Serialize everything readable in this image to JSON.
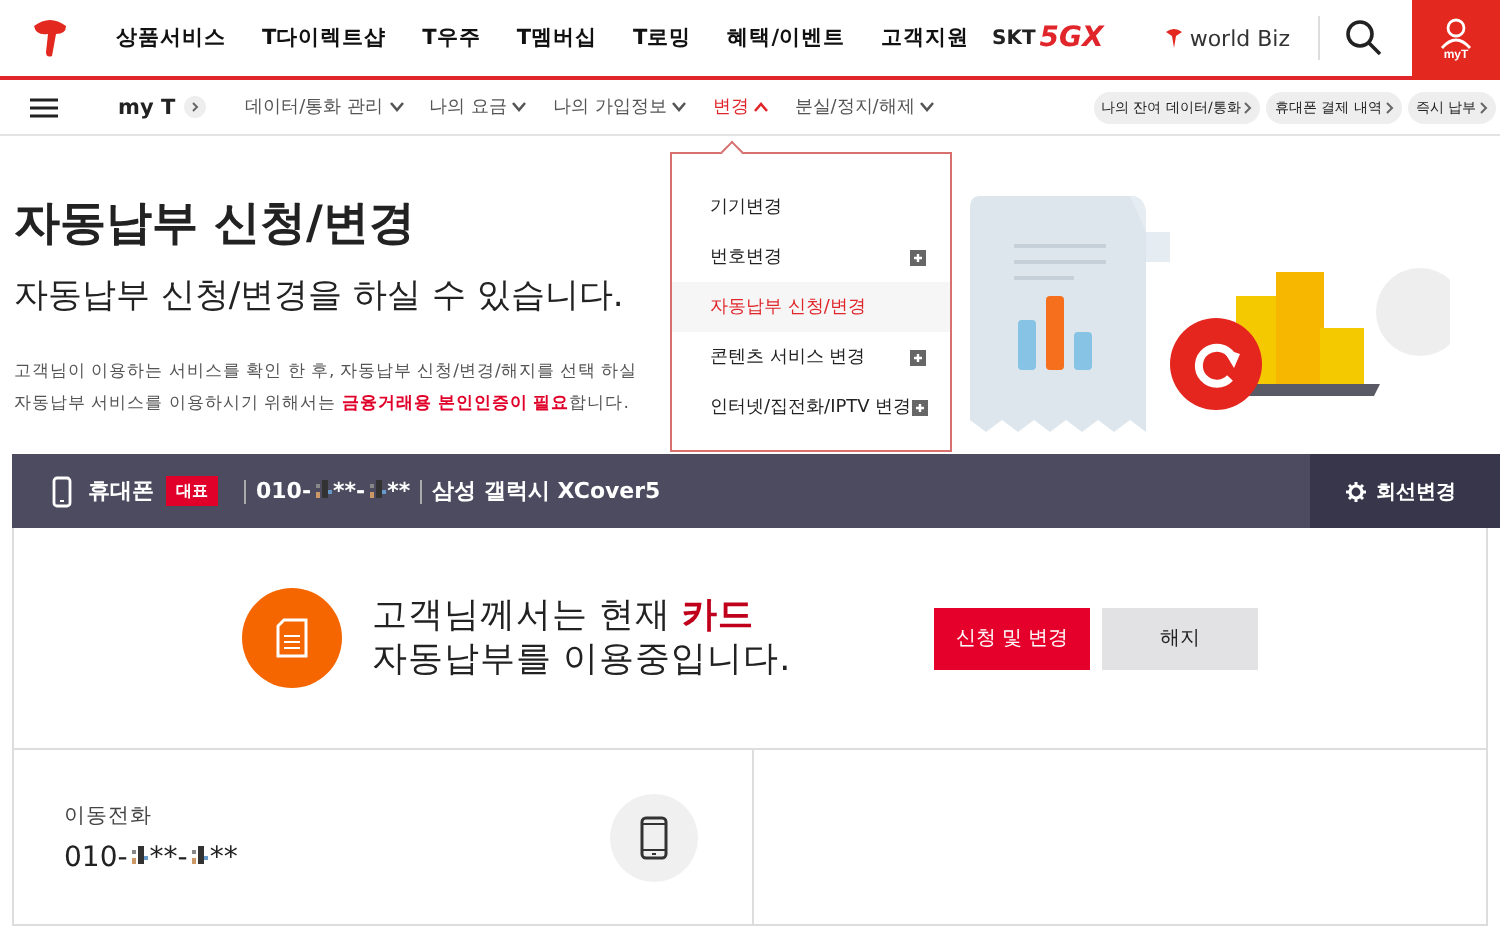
{
  "header": {
    "menu": [
      "상품서비스",
      "T다이렉트샵",
      "T우주",
      "T멤버십",
      "T로밍",
      "혜택/이벤트",
      "고객지원"
    ],
    "brand": "SKT",
    "brand_mark": "5GX",
    "partner": "world Biz",
    "account_label": "myT"
  },
  "nav": {
    "home": "my T",
    "items": [
      {
        "label": "데이터/통화 관리",
        "selected": false,
        "expanded": false
      },
      {
        "label": "나의 요금",
        "selected": false,
        "expanded": false
      },
      {
        "label": "나의 가입정보",
        "selected": false,
        "expanded": false
      },
      {
        "label": "변경",
        "selected": true,
        "expanded": true
      },
      {
        "label": "분실/정지/해제",
        "selected": false,
        "expanded": false
      }
    ],
    "quick_links": [
      "나의 잔여 데이터/통화",
      "휴대폰 결제 내역",
      "즉시 납부"
    ]
  },
  "dropdown": {
    "items": [
      {
        "label": "기기변경",
        "selected": false,
        "expandable": false
      },
      {
        "label": "번호변경",
        "selected": false,
        "expandable": true
      },
      {
        "label": "자동납부 신청/변경",
        "selected": true,
        "expandable": false
      },
      {
        "label": "콘텐츠 서비스 변경",
        "selected": false,
        "expandable": true
      },
      {
        "label": "인터넷/집전화/IPTV 변경",
        "selected": false,
        "expandable": true
      }
    ]
  },
  "page": {
    "title": "자동납부 신청/변경",
    "subtitle": "자동납부 신청/변경을 하실 수 있습니다.",
    "notice_lines": [
      "고객님이 이용하는 서비스를 확인 한 후, 자동납부 신청/변경/해지를 선택 하실",
      "자동납부 서비스를 이용하시기 위해서는 **금융거래용 본인인증이 필요**합니다."
    ]
  },
  "line_bar": {
    "device": "휴대폰",
    "badge": "대표",
    "number_parts": [
      "010-",
      "**-",
      "**"
    ],
    "model": "삼성 갤럭시 XCover5",
    "change_button": "회선변경"
  },
  "status": {
    "prefix": "고객님께서는 현재",
    "method": "카드",
    "suffix": "자동납부를 이용중입니다.",
    "buttons": [
      "신청 및 변경",
      "해지"
    ]
  },
  "line_card": {
    "label": "이동전화",
    "number_parts": [
      "010-",
      "**-",
      "**"
    ]
  }
}
